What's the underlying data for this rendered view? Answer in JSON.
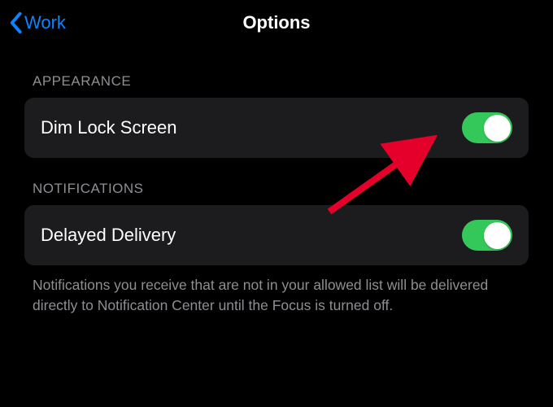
{
  "nav": {
    "back_label": "Work",
    "title": "Options"
  },
  "sections": {
    "appearance": {
      "header": "APPEARANCE",
      "dim_lock_screen": {
        "label": "Dim Lock Screen",
        "enabled": true
      }
    },
    "notifications": {
      "header": "NOTIFICATIONS",
      "delayed_delivery": {
        "label": "Delayed Delivery",
        "enabled": true
      },
      "footer": "Notifications you receive that are not in your allowed list will be delivered directly to Notification Center until the Focus is turned off."
    }
  },
  "colors": {
    "accent": "#0a84ff",
    "toggle_on": "#34c759",
    "cell_bg": "#1c1c1e",
    "secondary_text": "#8e8e93"
  },
  "annotation": {
    "arrow_points_to": "dim-lock-screen-toggle"
  }
}
